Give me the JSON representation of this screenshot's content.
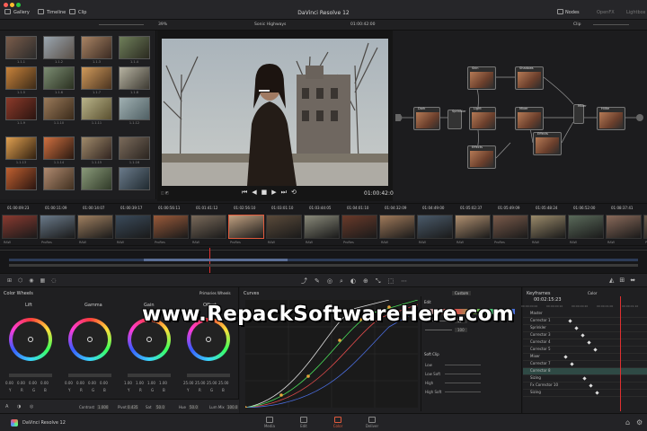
{
  "app": {
    "title": "DaVinci Resolve 12",
    "product_label": "DaVinci Resolve 12"
  },
  "topbar": {
    "gallery": "Gallery",
    "timeline": "Timeline",
    "clip": "Clip",
    "nodes": "Nodes",
    "openfx": "OpenFX",
    "lightbox": "Lightbox"
  },
  "viewer": {
    "zoom": "39%",
    "name": "Sonic Highways",
    "timecode_top": "01:00:42:00",
    "timecode_bottom": "01:00:42:00",
    "clip_label": "Clip"
  },
  "gallery": {
    "labels": [
      "1.1.1",
      "1.1.2",
      "1.1.3",
      "1.1.4",
      "1.1.5",
      "1.1.6",
      "1.1.7",
      "1.1.8",
      "1.1.9",
      "1.1.10",
      "1.1.11",
      "1.1.12",
      "1.1.13",
      "1.1.14",
      "1.1.15",
      "1.1.16"
    ]
  },
  "nodes": {
    "labels": [
      "Skin",
      "Shadows",
      "Dark",
      "Sprinkler",
      "Light",
      "Mixer",
      "Effects",
      "Hilite",
      "Mixer",
      "Effects"
    ]
  },
  "clips": {
    "timecodes": [
      "01:00:09:23",
      "01:00:11:09",
      "01:00:14:07",
      "01:00:39:17",
      "01:00:56:11",
      "01:01:41:12",
      "01:02:56:10",
      "01:03:01:10",
      "01:03:44:05",
      "01:04:01:10",
      "01:04:32:09",
      "01:04:49:00",
      "01:05:02:37",
      "01:05:49:09",
      "01:05:48:24",
      "01:06:52:00",
      "01:08:37:41",
      "01:09:52:09"
    ],
    "labels": [
      "RAW",
      "ProRes",
      "RAW",
      "RAW",
      "ProRes",
      "RAW",
      "ProRes",
      "RAW",
      "RAW",
      "ProRes",
      "RAW",
      "RAW",
      "RAW",
      "ProRes",
      "RAW",
      "RAW",
      "RAW",
      "ProRes"
    ]
  },
  "color_wheels": {
    "header": "Color Wheels",
    "mode": "Primaries Wheels",
    "wheels": [
      {
        "name": "Lift",
        "values": [
          "0.00",
          "0.00",
          "0.00",
          "0.00"
        ]
      },
      {
        "name": "Gamma",
        "values": [
          "0.00",
          "0.00",
          "0.00",
          "0.00"
        ]
      },
      {
        "name": "Gain",
        "values": [
          "1.00",
          "1.00",
          "1.00",
          "1.00"
        ]
      },
      {
        "name": "Offset",
        "values": [
          "25.00",
          "25.00",
          "25.00",
          "25.00"
        ]
      }
    ],
    "channel_labels": [
      "Y",
      "R",
      "G",
      "B"
    ],
    "footer": {
      "contrast": "Contrast",
      "contrast_val": "1.000",
      "pivot": "Pivot",
      "pivot_val": "0.435",
      "sat": "Sat",
      "sat_val": "50.0",
      "hue": "Hue",
      "hue_val": "50.0",
      "lum_mix": "Lum Mix",
      "lum_mix_val": "100.0"
    }
  },
  "curves": {
    "header": "Curves",
    "mode": "Custom",
    "edit": "Edit",
    "values": [
      "100",
      "100"
    ],
    "soft_clip": "Soft Clip",
    "low": "Low",
    "low_soft": "Low Soft",
    "high": "High",
    "high_soft": "High Soft"
  },
  "keyframes": {
    "header": "Keyframes",
    "mode": "Color",
    "timecode": "00:02:15:23",
    "ruler": [
      "00:00:00:00",
      "00:00:00:10",
      "00:00:00:20",
      "00:00:01:00",
      "00:00:01:10"
    ],
    "rows": [
      "Master",
      "Corrector 1",
      "Sprinkler",
      "Corrector 3",
      "Corrector 4",
      "Corrector 5",
      "Mixer",
      "Corrector 7",
      "Corrector 8",
      "Sizing",
      "Fx Corrector 10",
      "Sizing"
    ]
  },
  "pages": [
    "Media",
    "Edit",
    "Color",
    "Deliver"
  ],
  "watermark": "www.RepackSoftwareHere.com",
  "colors": {
    "accent": "#e05a3c",
    "active_page": "#e05a3c",
    "playhead": "#e03030"
  }
}
